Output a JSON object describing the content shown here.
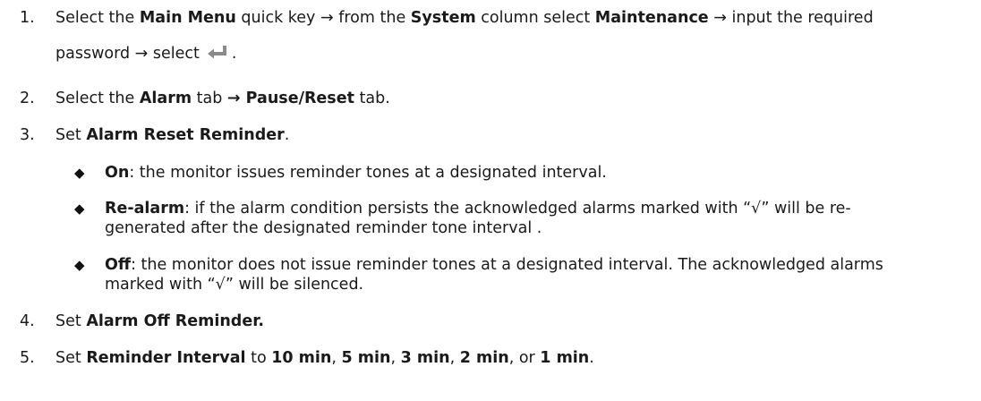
{
  "arrow": "→",
  "steps": [
    {
      "num": "1.",
      "t1": "Select the ",
      "b1": "Main Menu",
      "t2": " quick key ",
      "t3": " from the ",
      "b2": "System",
      "t4": " column select ",
      "b3": "Maintenance",
      "t5": " ",
      "t6": " input the required",
      "line2_a": "password ",
      "line2_b": " select",
      "line2_c": ".",
      "icon": "enter-key-icon"
    },
    {
      "num": "2.",
      "t1": "Select the ",
      "b1": "Alarm",
      "t2": " tab ",
      "b2": " Pause/Reset",
      "t3": " tab."
    },
    {
      "num": "3.",
      "t1": "Set ",
      "b1": "Alarm Reset Reminder",
      "t2": "."
    },
    {
      "num": "4.",
      "t1": "Set ",
      "b1": "Alarm Off Reminder."
    },
    {
      "num": "5.",
      "t1": "Set ",
      "b1": "Reminder Interval",
      "t2": " to ",
      "v1": "10 min",
      "s1": ", ",
      "v2": "5 min",
      "s2": ", ",
      "v3": "3 min",
      "s3": ", ",
      "v4": "2 min",
      "s4": ", or ",
      "v5": "1 min",
      "s5": "."
    }
  ],
  "bullets": [
    {
      "marker": "◆",
      "label": "On",
      "text": ": the monitor issues reminder tones at a designated interval."
    },
    {
      "marker": "◆",
      "label": "Re-alarm",
      "text1": ": if the alarm condition persists the acknowledged alarms marked with “√” will be re-",
      "text2": "generated after the designated reminder tone interval ."
    },
    {
      "marker": "◆",
      "label": "Off",
      "text1": ": the monitor does not issue reminder tones at a designated interval. The acknowledged alarms",
      "text2": "marked with “√” will be silenced."
    }
  ]
}
